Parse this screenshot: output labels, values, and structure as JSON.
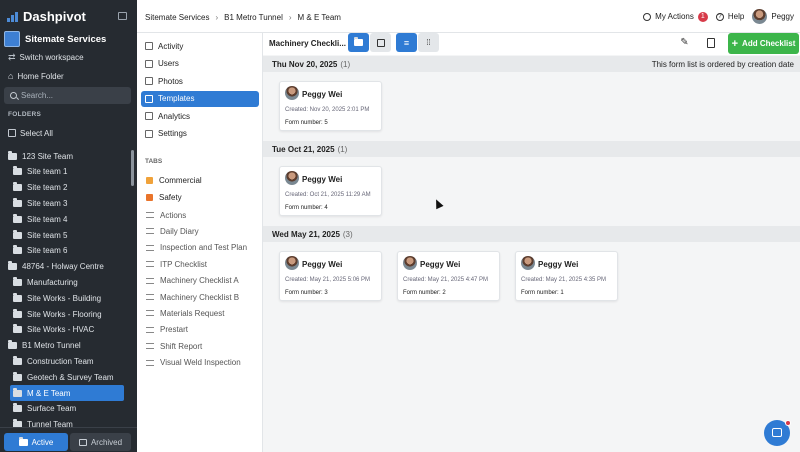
{
  "sidebar": {
    "brand": "Dashpivot",
    "workspace": "Sitemate Services",
    "switch_workspace": "Switch workspace",
    "home_folder": "Home Folder",
    "search_placeholder": "Search...",
    "folders_header": "FOLDERS",
    "select_all": "Select All",
    "folders": [
      {
        "label": "123 Site Team",
        "level": 0
      },
      {
        "label": "Site team 1",
        "level": 1
      },
      {
        "label": "Site team 2",
        "level": 1
      },
      {
        "label": "Site team 3",
        "level": 1
      },
      {
        "label": "Site team 4",
        "level": 1
      },
      {
        "label": "Site team 5",
        "level": 1
      },
      {
        "label": "Site team 6",
        "level": 1
      },
      {
        "label": "48764 - Holway Centre",
        "level": 0
      },
      {
        "label": "Manufacturing",
        "level": 1
      },
      {
        "label": "Site Works - Building",
        "level": 1
      },
      {
        "label": "Site Works - Flooring",
        "level": 1
      },
      {
        "label": "Site Works - HVAC",
        "level": 1
      },
      {
        "label": "B1 Metro Tunnel",
        "level": 0
      },
      {
        "label": "Construction Team",
        "level": 1
      },
      {
        "label": "Geotech & Survey Team",
        "level": 1
      },
      {
        "label": "M & E Team",
        "level": 1,
        "selected": true
      },
      {
        "label": "Surface Team",
        "level": 1
      },
      {
        "label": "Tunnel Team",
        "level": 1
      }
    ],
    "active_tab": "Active",
    "archived_tab": "Archived"
  },
  "topbar": {
    "breadcrumb": [
      "Sitemate Services",
      "B1 Metro Tunnel",
      "M & E Team"
    ],
    "my_actions": "My Actions",
    "actions_count": "1",
    "help": "Help",
    "user": "Peggy"
  },
  "nav": {
    "items": [
      "Activity",
      "Users",
      "Photos",
      "Templates",
      "Analytics",
      "Settings"
    ],
    "selected": "Templates",
    "tabs_header": "TABS",
    "tabs": [
      {
        "label": "Commercial",
        "color": "#f0a23a"
      },
      {
        "label": "Safety",
        "color": "#e9742b"
      }
    ],
    "templates": [
      "Actions",
      "Daily Diary",
      "Inspection and Test Plan",
      "ITP Checklist",
      "Machinery Checklist A",
      "Machinery Checklist B",
      "Materials Request",
      "Prestart",
      "Shift Report",
      "Visual Weld Inspection"
    ]
  },
  "main": {
    "title": "Machinery Checkli...",
    "add_button": "Add Checklist",
    "order_note": "This form list is ordered by creation date",
    "groups": [
      {
        "date": "Thu Nov 20, 2025",
        "count": "(1)",
        "cards": [
          {
            "name": "Peggy Wei",
            "created": "Created: Nov 20, 2025 2:01 PM",
            "form": "Form number: 5"
          }
        ]
      },
      {
        "date": "Tue Oct 21, 2025",
        "count": "(1)",
        "cards": [
          {
            "name": "Peggy Wei",
            "created": "Created: Oct 21, 2025 11:29 AM",
            "form": "Form number: 4"
          }
        ]
      },
      {
        "date": "Wed May 21, 2025",
        "count": "(3)",
        "cards": [
          {
            "name": "Peggy Wei",
            "created": "Created: May 21, 2025 5:06 PM",
            "form": "Form number: 3"
          },
          {
            "name": "Peggy Wei",
            "created": "Created: May 21, 2025 4:47 PM",
            "form": "Form number: 2"
          },
          {
            "name": "Peggy Wei",
            "created": "Created: May 21, 2025 4:35 PM",
            "form": "Form number: 1"
          }
        ]
      }
    ]
  },
  "colors": {
    "accent": "#2f7bd4",
    "add": "#3cb54a",
    "sidebar": "#262b31"
  }
}
